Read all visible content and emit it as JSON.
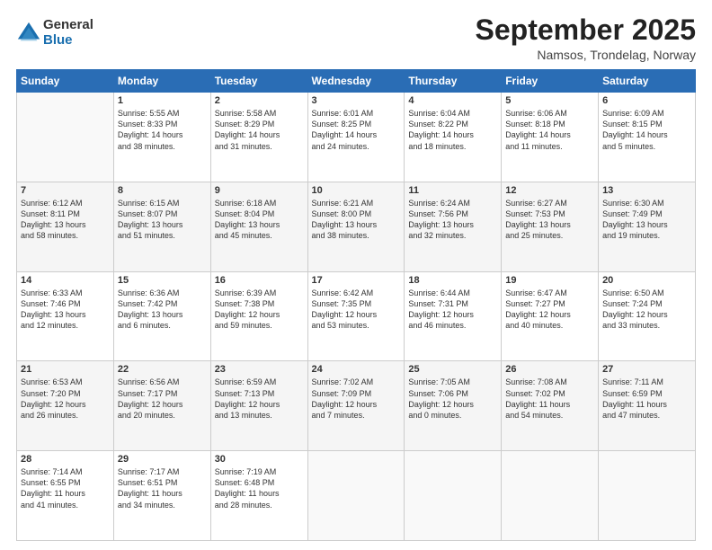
{
  "logo": {
    "general": "General",
    "blue": "Blue"
  },
  "header": {
    "month": "September 2025",
    "location": "Namsos, Trondelag, Norway"
  },
  "days": [
    "Sunday",
    "Monday",
    "Tuesday",
    "Wednesday",
    "Thursday",
    "Friday",
    "Saturday"
  ],
  "weeks": [
    [
      {
        "day": "",
        "info": ""
      },
      {
        "day": "1",
        "info": "Sunrise: 5:55 AM\nSunset: 8:33 PM\nDaylight: 14 hours\nand 38 minutes."
      },
      {
        "day": "2",
        "info": "Sunrise: 5:58 AM\nSunset: 8:29 PM\nDaylight: 14 hours\nand 31 minutes."
      },
      {
        "day": "3",
        "info": "Sunrise: 6:01 AM\nSunset: 8:25 PM\nDaylight: 14 hours\nand 24 minutes."
      },
      {
        "day": "4",
        "info": "Sunrise: 6:04 AM\nSunset: 8:22 PM\nDaylight: 14 hours\nand 18 minutes."
      },
      {
        "day": "5",
        "info": "Sunrise: 6:06 AM\nSunset: 8:18 PM\nDaylight: 14 hours\nand 11 minutes."
      },
      {
        "day": "6",
        "info": "Sunrise: 6:09 AM\nSunset: 8:15 PM\nDaylight: 14 hours\nand 5 minutes."
      }
    ],
    [
      {
        "day": "7",
        "info": "Sunrise: 6:12 AM\nSunset: 8:11 PM\nDaylight: 13 hours\nand 58 minutes."
      },
      {
        "day": "8",
        "info": "Sunrise: 6:15 AM\nSunset: 8:07 PM\nDaylight: 13 hours\nand 51 minutes."
      },
      {
        "day": "9",
        "info": "Sunrise: 6:18 AM\nSunset: 8:04 PM\nDaylight: 13 hours\nand 45 minutes."
      },
      {
        "day": "10",
        "info": "Sunrise: 6:21 AM\nSunset: 8:00 PM\nDaylight: 13 hours\nand 38 minutes."
      },
      {
        "day": "11",
        "info": "Sunrise: 6:24 AM\nSunset: 7:56 PM\nDaylight: 13 hours\nand 32 minutes."
      },
      {
        "day": "12",
        "info": "Sunrise: 6:27 AM\nSunset: 7:53 PM\nDaylight: 13 hours\nand 25 minutes."
      },
      {
        "day": "13",
        "info": "Sunrise: 6:30 AM\nSunset: 7:49 PM\nDaylight: 13 hours\nand 19 minutes."
      }
    ],
    [
      {
        "day": "14",
        "info": "Sunrise: 6:33 AM\nSunset: 7:46 PM\nDaylight: 13 hours\nand 12 minutes."
      },
      {
        "day": "15",
        "info": "Sunrise: 6:36 AM\nSunset: 7:42 PM\nDaylight: 13 hours\nand 6 minutes."
      },
      {
        "day": "16",
        "info": "Sunrise: 6:39 AM\nSunset: 7:38 PM\nDaylight: 12 hours\nand 59 minutes."
      },
      {
        "day": "17",
        "info": "Sunrise: 6:42 AM\nSunset: 7:35 PM\nDaylight: 12 hours\nand 53 minutes."
      },
      {
        "day": "18",
        "info": "Sunrise: 6:44 AM\nSunset: 7:31 PM\nDaylight: 12 hours\nand 46 minutes."
      },
      {
        "day": "19",
        "info": "Sunrise: 6:47 AM\nSunset: 7:27 PM\nDaylight: 12 hours\nand 40 minutes."
      },
      {
        "day": "20",
        "info": "Sunrise: 6:50 AM\nSunset: 7:24 PM\nDaylight: 12 hours\nand 33 minutes."
      }
    ],
    [
      {
        "day": "21",
        "info": "Sunrise: 6:53 AM\nSunset: 7:20 PM\nDaylight: 12 hours\nand 26 minutes."
      },
      {
        "day": "22",
        "info": "Sunrise: 6:56 AM\nSunset: 7:17 PM\nDaylight: 12 hours\nand 20 minutes."
      },
      {
        "day": "23",
        "info": "Sunrise: 6:59 AM\nSunset: 7:13 PM\nDaylight: 12 hours\nand 13 minutes."
      },
      {
        "day": "24",
        "info": "Sunrise: 7:02 AM\nSunset: 7:09 PM\nDaylight: 12 hours\nand 7 minutes."
      },
      {
        "day": "25",
        "info": "Sunrise: 7:05 AM\nSunset: 7:06 PM\nDaylight: 12 hours\nand 0 minutes."
      },
      {
        "day": "26",
        "info": "Sunrise: 7:08 AM\nSunset: 7:02 PM\nDaylight: 11 hours\nand 54 minutes."
      },
      {
        "day": "27",
        "info": "Sunrise: 7:11 AM\nSunset: 6:59 PM\nDaylight: 11 hours\nand 47 minutes."
      }
    ],
    [
      {
        "day": "28",
        "info": "Sunrise: 7:14 AM\nSunset: 6:55 PM\nDaylight: 11 hours\nand 41 minutes."
      },
      {
        "day": "29",
        "info": "Sunrise: 7:17 AM\nSunset: 6:51 PM\nDaylight: 11 hours\nand 34 minutes."
      },
      {
        "day": "30",
        "info": "Sunrise: 7:19 AM\nSunset: 6:48 PM\nDaylight: 11 hours\nand 28 minutes."
      },
      {
        "day": "",
        "info": ""
      },
      {
        "day": "",
        "info": ""
      },
      {
        "day": "",
        "info": ""
      },
      {
        "day": "",
        "info": ""
      }
    ]
  ]
}
